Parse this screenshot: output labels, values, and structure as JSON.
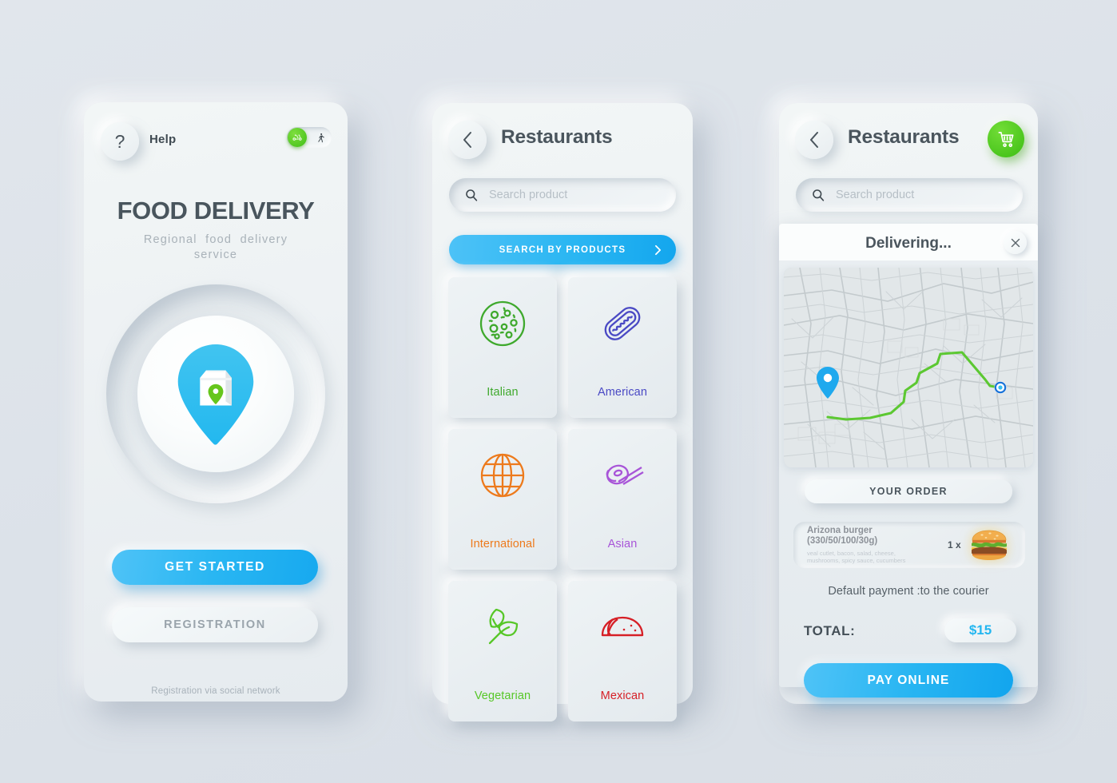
{
  "screen1": {
    "help_icon": "question-mark-icon",
    "help_label": "Help",
    "toggle": {
      "active_mode": "scooter-icon",
      "inactive_mode": "walking-icon"
    },
    "title": "FOOD DELIVERY",
    "subtitle": "Regional  food  delivery\nservice",
    "hero_icon": "map-pin-with-food-bag",
    "primary_button": "GET  STARTED",
    "secondary_button": "REGISTRATION",
    "footer_note": "Registration via social network"
  },
  "screen2": {
    "back_icon": "chevron-left-icon",
    "title": "Restaurants",
    "search": {
      "icon": "search-icon",
      "placeholder": "Search product",
      "value": ""
    },
    "search_products_button": "SEARCH BY PRODUCTS",
    "search_products_chevron": "chevron-right-icon",
    "categories": [
      {
        "label": "Italian",
        "icon": "pizza-icon",
        "color": "#3fa92d"
      },
      {
        "label": "American",
        "icon": "hotdog-icon",
        "color": "#4a49c4"
      },
      {
        "label": "International",
        "icon": "globe-icon",
        "color": "#ed7a1c"
      },
      {
        "label": "Asian",
        "icon": "sushi-icon",
        "color": "#a855d8"
      },
      {
        "label": "Vegetarian",
        "icon": "leaves-icon",
        "color": "#57c728"
      },
      {
        "label": "Mexican",
        "icon": "taco-icon",
        "color": "#d61f26"
      }
    ]
  },
  "screen3": {
    "back_icon": "chevron-left-icon",
    "title": "Restaurants",
    "cart_icon": "shopping-cart-icon",
    "cart_color": "#45c41c",
    "search": {
      "icon": "search-icon",
      "placeholder": "Search product",
      "value": ""
    },
    "delivering_title": "Delivering...",
    "close_icon": "close-icon",
    "map": {
      "route_color": "#5cc832",
      "origin_marker": "map-pin-icon",
      "destination_marker": "destination-dot-icon"
    },
    "your_order_label": "YOUR ORDER",
    "order_item": {
      "name": "Arizona burger",
      "weight": "(330/50/100/30g)",
      "description": "veal cutlet, bacon, salad, cheese,\nmushrooms, spicy sauce, cucumbers",
      "quantity": "1 x",
      "image": "burger-image"
    },
    "payment_note": "Default payment :to the courier",
    "total_label": "TOTAL:",
    "total_value": "$15",
    "total_color": "#23b6f0",
    "pay_button": "PAY ONLINE"
  }
}
